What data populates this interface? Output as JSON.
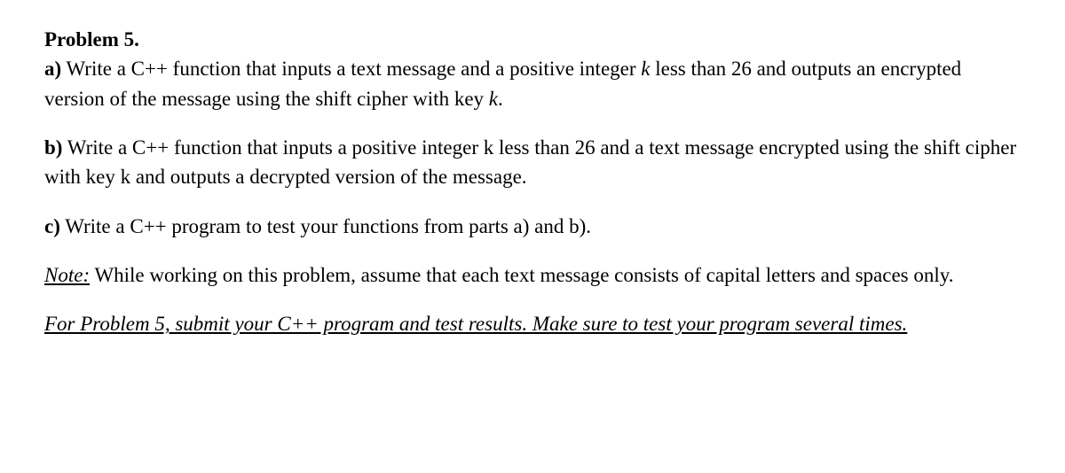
{
  "problem": {
    "title": "Problem 5.",
    "partA": {
      "label": "a)",
      "text1": " Write a C++ function that inputs a text message and a positive integer ",
      "var1": "k",
      "text2": " less than 26 and outputs an encrypted version of the message using the shift cipher with key ",
      "var2": "k",
      "text3": "."
    },
    "partB": {
      "label": "b)",
      "text": " Write a C++ function that inputs a positive integer k less than 26 and a text message encrypted using the shift cipher with key k and outputs a decrypted version of the message."
    },
    "partC": {
      "label": "c)",
      "text": " Write a C++ program to test your functions from parts a) and b)."
    },
    "note": {
      "label": "Note:",
      "text": " While working on this problem, assume that each text message consists of capital letters and spaces only."
    },
    "submit": {
      "text": "For Problem 5, submit your C++ program and test results. Make sure to test your program several times."
    }
  }
}
